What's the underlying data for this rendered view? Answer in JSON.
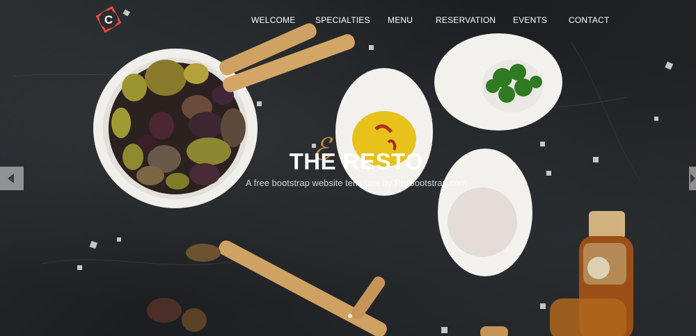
{
  "brand": {
    "logo_letter": "C",
    "accent_color": "#e04b43"
  },
  "nav": {
    "items": [
      {
        "label": "WELCOME"
      },
      {
        "label": "SPECIALTIES"
      },
      {
        "label": "MENU"
      },
      {
        "label": "RESERVATION"
      },
      {
        "label": "EVENTS"
      },
      {
        "label": "CONTACT"
      }
    ]
  },
  "hero": {
    "title": "THE RESTO",
    "subtitle": "A free bootstrap website template by ProBootstrap.com",
    "prev_icon": "chevron-left-icon",
    "next_icon": "chevron-right-icon"
  }
}
